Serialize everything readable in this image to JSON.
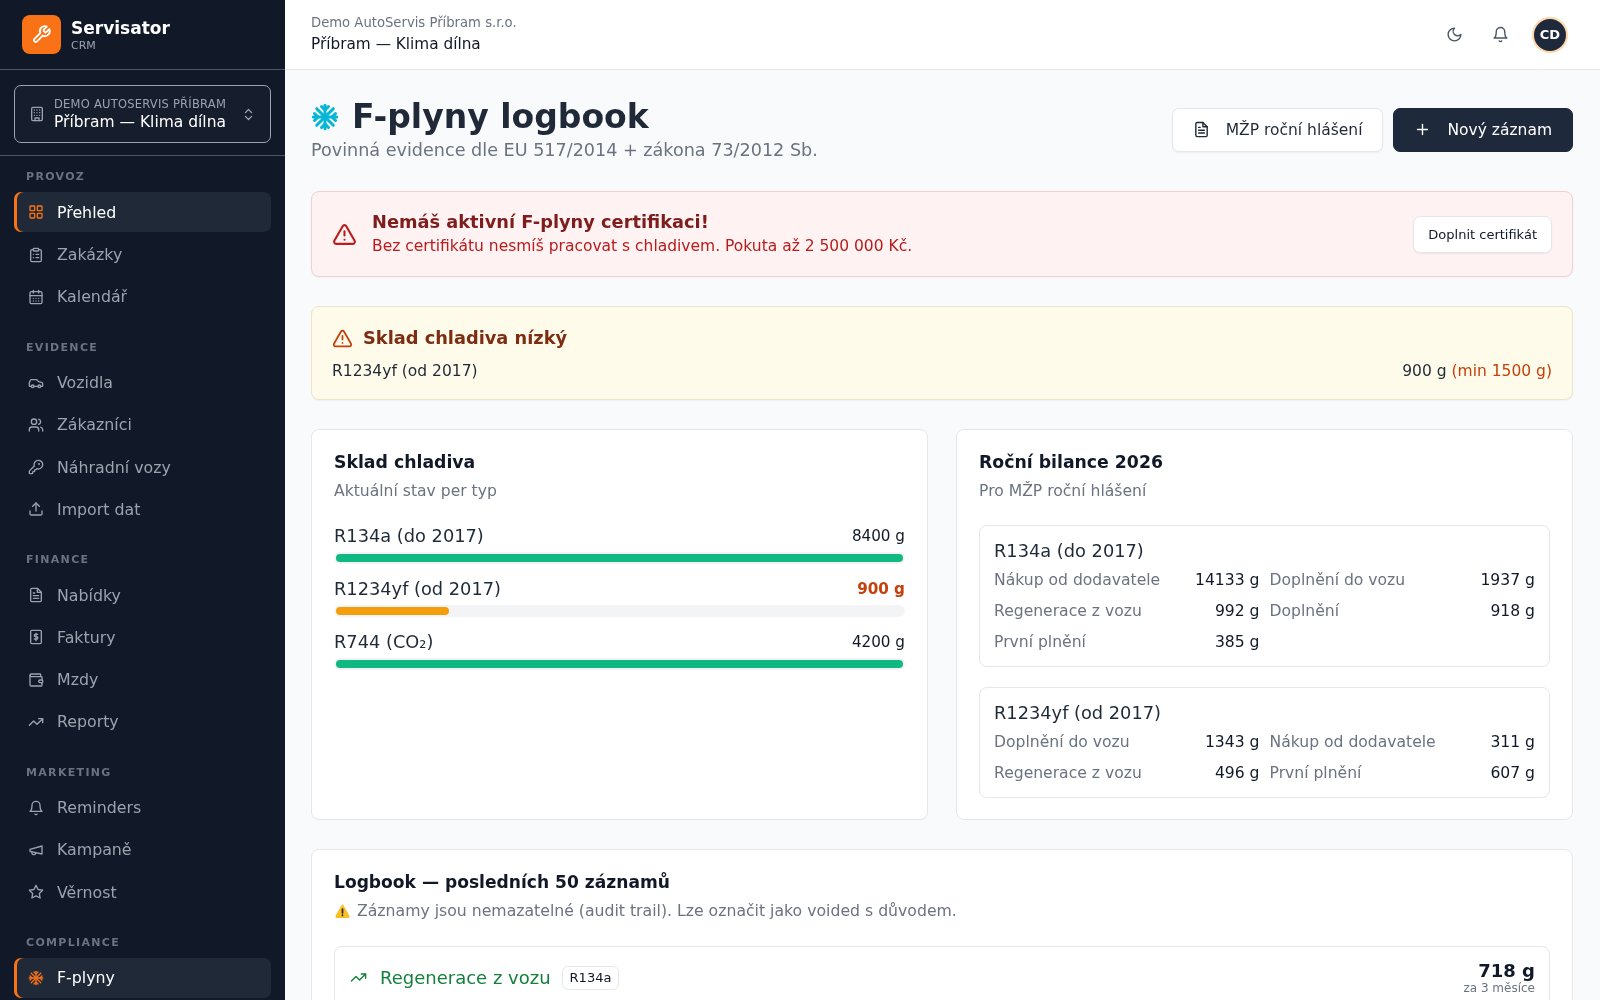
{
  "sidebar": {
    "brand": {
      "name": "Servisator",
      "tagline": "CRM"
    },
    "org_switcher": {
      "company": "DEMO AUTOSERVIS PŘÍBRAM",
      "branch": "Příbram — Klima dílna"
    },
    "sections": [
      {
        "label": "PROVOZ",
        "items": [
          {
            "label": "Přehled",
            "selected": true
          },
          {
            "label": "Zakázky",
            "selected": false
          },
          {
            "label": "Kalendář",
            "selected": false
          }
        ]
      },
      {
        "label": "EVIDENCE",
        "items": [
          {
            "label": "Vozidla",
            "selected": false
          },
          {
            "label": "Zákazníci",
            "selected": false
          },
          {
            "label": "Náhradní vozy",
            "selected": false
          },
          {
            "label": "Import dat",
            "selected": false
          }
        ]
      },
      {
        "label": "FINANCE",
        "items": [
          {
            "label": "Nabídky",
            "selected": false
          },
          {
            "label": "Faktury",
            "selected": false
          },
          {
            "label": "Mzdy",
            "selected": false
          },
          {
            "label": "Reporty",
            "selected": false
          }
        ]
      },
      {
        "label": "MARKETING",
        "items": [
          {
            "label": "Reminders",
            "selected": false
          },
          {
            "label": "Kampaně",
            "selected": false
          },
          {
            "label": "Věrnost",
            "selected": false
          }
        ]
      },
      {
        "label": "COMPLIANCE",
        "items": [
          {
            "label": "F-plyny",
            "selected": true
          }
        ]
      }
    ]
  },
  "header": {
    "company": "Demo AutoServis Příbram s.r.o.",
    "branch": "Příbram — Klima dílna",
    "avatar": "CD"
  },
  "page": {
    "title": "F-plyny logbook",
    "subtitle": "Povinná evidence dle EU 517/2014 + zákona 73/2012 Sb.",
    "actions": [
      {
        "label": "MŽP roční hlášení",
        "kind": "secondary"
      },
      {
        "label": "Nový záznam",
        "kind": "primary"
      }
    ]
  },
  "alerts": [
    {
      "kind": "error",
      "title": "Nemáš aktivní F-plyny certifikaci!",
      "message": "Bez certifikátu nesmíš pracovat s chladivem. Pokuta až 2 500 000 Kč.",
      "action": "Doplnit certifikát"
    },
    {
      "kind": "warning",
      "title": "Sklad chladiva nízký",
      "rows": [
        {
          "name": "R1234yf (od 2017)",
          "amount": "900 g",
          "minimum": "(min 1500 g)"
        }
      ]
    }
  ],
  "stock": {
    "title": "Sklad chladiva",
    "subtitle": "Aktuální stav per typ",
    "items": [
      {
        "name": "R134a (do 2017)",
        "amount": "8400 g",
        "level": 1,
        "low": false
      },
      {
        "name": "R1234yf (od 2017)",
        "amount": "900 g",
        "level": 0.2,
        "low": true
      },
      {
        "name": "R744 (CO₂)",
        "amount": "4200 g",
        "level": 1,
        "low": false
      }
    ]
  },
  "balance": {
    "title": "Roční bilance 2026",
    "subtitle": "Pro MŽP roční hlášení",
    "groups": [
      {
        "name": "R134a (do 2017)",
        "rows": [
          {
            "label": "Nákup od dodavatele",
            "value": "14133 g"
          },
          {
            "label": "Doplnění do vozu",
            "value": "1937 g"
          },
          {
            "label": "Regenerace z vozu",
            "value": "992 g"
          },
          {
            "label": "Doplnění",
            "value": "918 g"
          },
          {
            "label": "První plnění",
            "value": "385 g"
          }
        ]
      },
      {
        "name": "R1234yf (od 2017)",
        "rows": [
          {
            "label": "Doplnění do vozu",
            "value": "1343 g"
          },
          {
            "label": "Nákup od dodavatele",
            "value": "311 g"
          },
          {
            "label": "Regenerace z vozu",
            "value": "496 g"
          },
          {
            "label": "První plnění",
            "value": "607 g"
          }
        ]
      }
    ]
  },
  "logbook": {
    "title": "Logbook — posledních 50 záznamů",
    "note": "Záznamy jsou nemazatelné (audit trail). Lze označit jako voided s důvodem.",
    "entries": [
      {
        "kind": "recovery",
        "type": "Regenerace z vozu",
        "refrigerant": "R134a",
        "amount": "718 g",
        "time": "za 3 měsíce"
      }
    ]
  }
}
